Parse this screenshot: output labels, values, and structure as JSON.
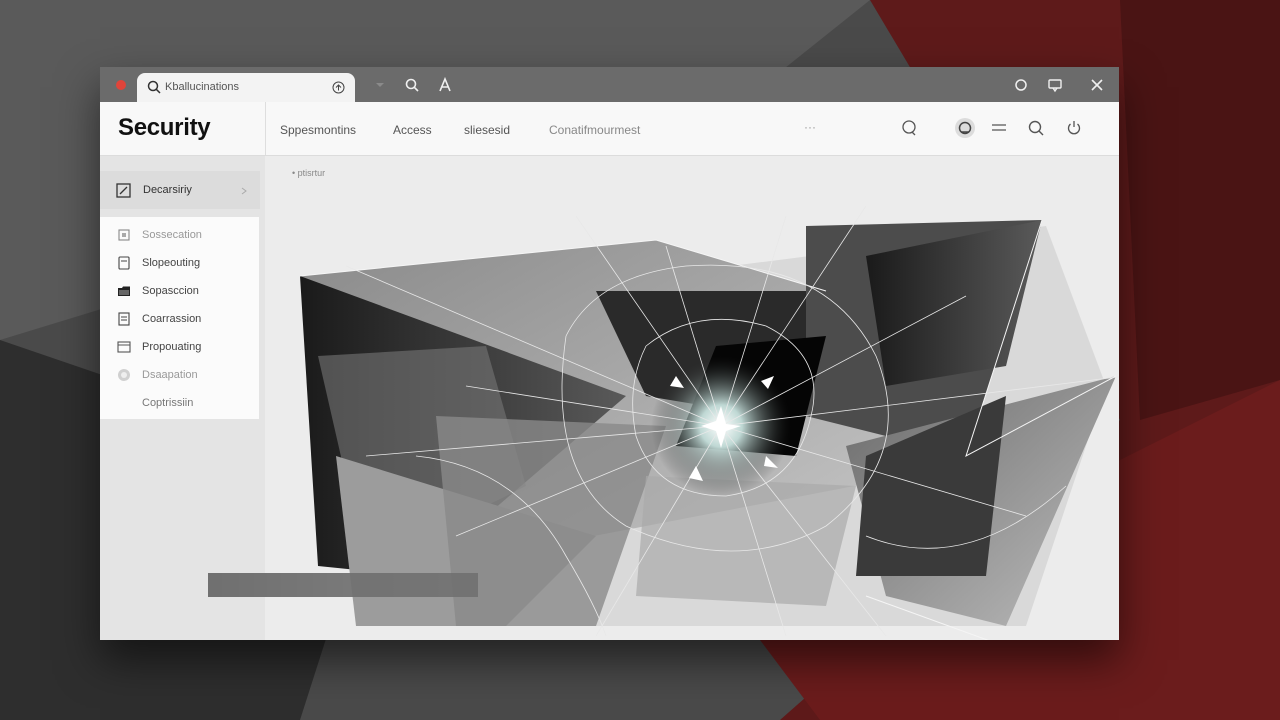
{
  "window": {
    "tab": {
      "label": "Kballucinations"
    }
  },
  "header": {
    "title": "Security",
    "nav_tabs": [
      {
        "label": "Sppesmontins"
      },
      {
        "label": "Access"
      },
      {
        "label": "sliesesid"
      },
      {
        "label": "Conatifmourmest"
      }
    ],
    "more": "···"
  },
  "sidebar": {
    "head_label": "Decarsiriy",
    "items": [
      {
        "label": "Sossecation",
        "icon": "square-icon"
      },
      {
        "label": "Slopeouting",
        "icon": "document-icon"
      },
      {
        "label": "Sopasccion",
        "icon": "folder-icon"
      },
      {
        "label": "Coarrassion",
        "icon": "checklist-icon"
      },
      {
        "label": "Propouating",
        "icon": "window-icon"
      },
      {
        "label": "Dsaapation",
        "icon": "circle-icon"
      },
      {
        "label": "Coptrissiin",
        "icon": ""
      }
    ]
  },
  "content": {
    "breadcrumb": "• ptisrtur"
  },
  "colors": {
    "close_dot": "#e0443a",
    "accent_red": "#7a1f1f",
    "titlebar": "#6b6b6b"
  }
}
